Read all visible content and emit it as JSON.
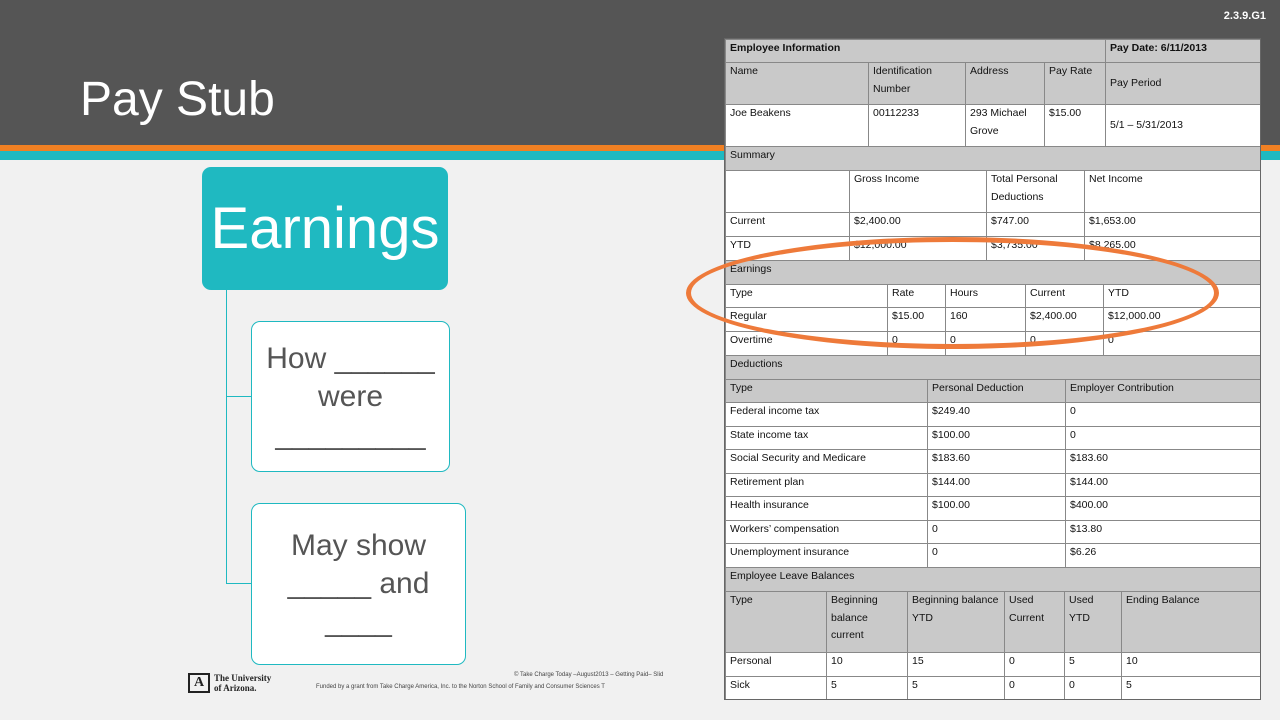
{
  "slide": {
    "title": "Pay Stub",
    "code": "2.3.9.G1"
  },
  "diagram": {
    "main": "Earnings",
    "items": [
      "How ______ were _________",
      "May show _____ and ____"
    ]
  },
  "footer": {
    "logo_line1": "The University",
    "logo_line2": "of Arizona.",
    "copyright": "© Take Charge Today –August2013 – Getting Paid– Slid",
    "funding": "Funded by a grant from Take Charge America, Inc. to the Norton School of Family and Consumer Sciences T"
  },
  "pay_stub": {
    "employee_info": {
      "header": "Employee Information",
      "pay_date": "Pay Date: 6/11/2013",
      "columns": [
        "Name",
        "Identification Number",
        "Address",
        "Pay Rate",
        "Pay Period"
      ],
      "row": [
        "Joe Beakens",
        "00112233",
        "293 Michael Grove",
        "$15.00",
        "5/1 – 5/31/2013"
      ]
    },
    "summary": {
      "header": "Summary",
      "columns": [
        "",
        "Gross Income",
        "Total Personal Deductions",
        "Net Income"
      ],
      "rows": [
        [
          "Current",
          "$2,400.00",
          "$747.00",
          "$1,653.00"
        ],
        [
          "YTD",
          "$12,000.00",
          "$3,735.00",
          "$8,265.00"
        ]
      ]
    },
    "earnings": {
      "header": "Earnings",
      "columns": [
        "Type",
        "Rate",
        "Hours",
        "Current",
        "YTD"
      ],
      "rows": [
        [
          "Regular",
          "$15.00",
          "160",
          "$2,400.00",
          "$12,000.00"
        ],
        [
          "Overtime",
          "0",
          "0",
          "0",
          "0"
        ]
      ]
    },
    "deductions": {
      "header": "Deductions",
      "columns": [
        "Type",
        "Personal Deduction",
        "Employer Contribution"
      ],
      "rows": [
        [
          "Federal income tax",
          "$249.40",
          "0"
        ],
        [
          "State income tax",
          "$100.00",
          "0"
        ],
        [
          "Social Security and Medicare",
          "$183.60",
          "$183.60"
        ],
        [
          "Retirement plan",
          "$144.00",
          "$144.00"
        ],
        [
          "Health insurance",
          "$100.00",
          "$400.00"
        ],
        [
          "Workers’ compensation",
          "0",
          "$13.80"
        ],
        [
          "Unemployment insurance",
          "0",
          "$6.26"
        ]
      ]
    },
    "leave": {
      "header": "Employee Leave Balances",
      "columns": [
        "Type",
        "Beginning balance current",
        "Beginning balance YTD",
        "Used Current",
        "Used YTD",
        "Ending Balance"
      ],
      "rows": [
        [
          "Personal",
          "10",
          "15",
          "0",
          "5",
          "10"
        ],
        [
          "Sick",
          "5",
          "5",
          "0",
          "0",
          "5"
        ]
      ]
    }
  },
  "colors": {
    "header_gray": "#555555",
    "teal": "#1fb9c1",
    "orange": "#f08023",
    "highlight_orange": "#ee7a3a",
    "table_header_gray": "#c9c9c9"
  }
}
